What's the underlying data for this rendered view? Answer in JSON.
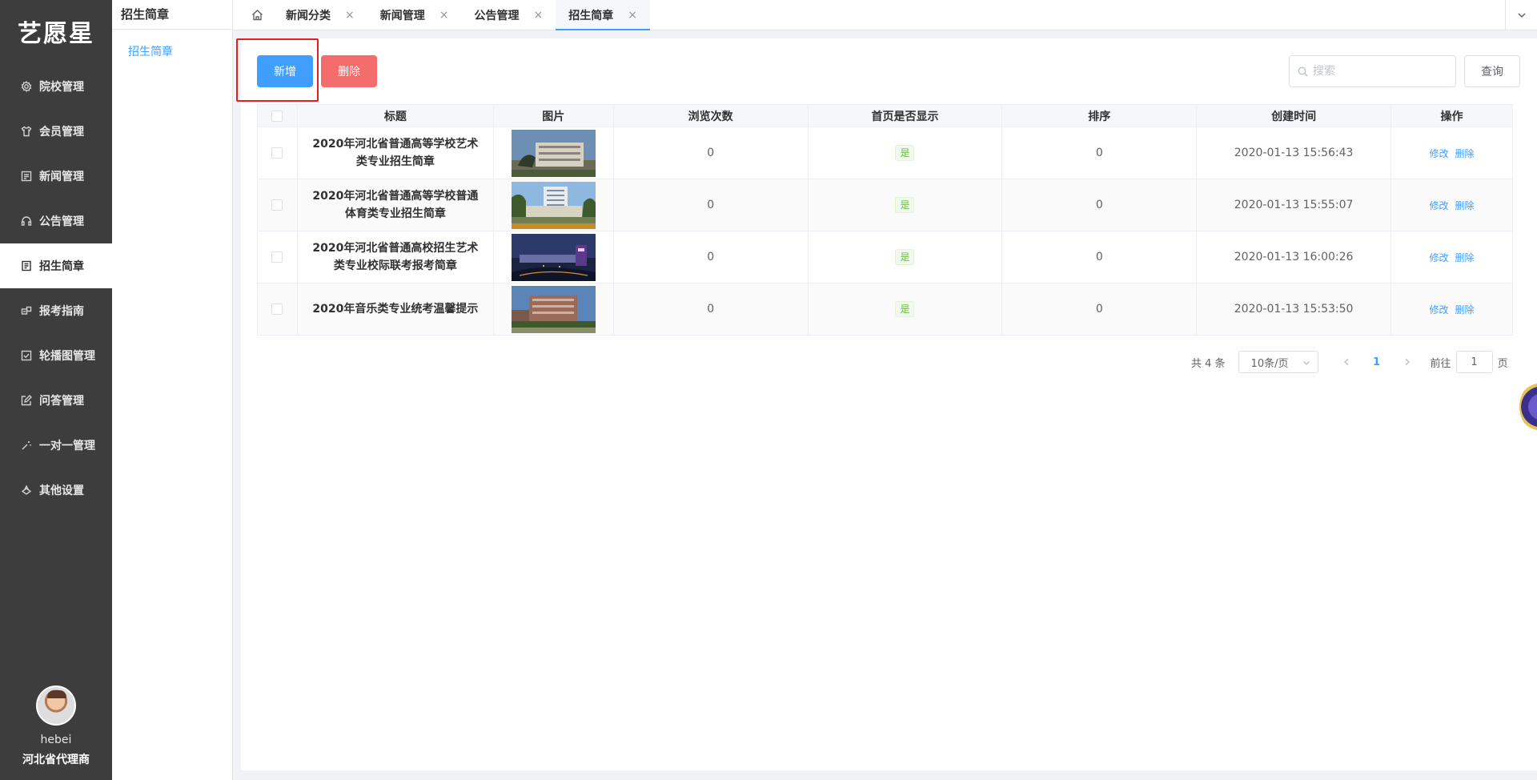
{
  "brand": {
    "logo_text": "艺愿星"
  },
  "sidebar": {
    "items": [
      {
        "label": "院校管理",
        "icon": "gear-icon",
        "active": false
      },
      {
        "label": "会员管理",
        "icon": "shirt-icon",
        "active": false
      },
      {
        "label": "新闻管理",
        "icon": "news-icon",
        "active": false
      },
      {
        "label": "公告管理",
        "icon": "headset-icon",
        "active": false
      },
      {
        "label": "招生简章",
        "icon": "document-icon",
        "active": true
      },
      {
        "label": "报考指南",
        "icon": "guide-icon",
        "active": false
      },
      {
        "label": "轮播图管理",
        "icon": "checkbox-icon",
        "active": false
      },
      {
        "label": "问答管理",
        "icon": "edit-icon",
        "active": false
      },
      {
        "label": "一对一管理",
        "icon": "magic-stick-icon",
        "active": false
      },
      {
        "label": "其他设置",
        "icon": "coin-icon",
        "active": false
      }
    ]
  },
  "user": {
    "name": "hebei",
    "role": "河北省代理商"
  },
  "subsidebar": {
    "title": "招生简章",
    "items": [
      {
        "label": "招生简章"
      }
    ]
  },
  "tabs": [
    {
      "label": "新闻分类",
      "active": false
    },
    {
      "label": "新闻管理",
      "active": false
    },
    {
      "label": "公告管理",
      "active": false
    },
    {
      "label": "招生简章",
      "active": true
    }
  ],
  "tab_close_glyph": "×",
  "toolbar": {
    "add_label": "新增",
    "delete_label": "删除",
    "search_placeholder": "搜索",
    "search_value": "",
    "query_label": "查询"
  },
  "table": {
    "columns": [
      "标题",
      "图片",
      "浏览次数",
      "首页是否显示",
      "排序",
      "创建时间",
      "操作"
    ],
    "rows": [
      {
        "title": "2020年河北省普通高等学校艺术类专业招生简章",
        "views": "0",
        "show_home": "是",
        "sort": "0",
        "created": "2020-01-13 15:56:43"
      },
      {
        "title": "2020年河北省普通高等学校普通体育类专业招生简章",
        "views": "0",
        "show_home": "是",
        "sort": "0",
        "created": "2020-01-13 15:55:07"
      },
      {
        "title": "2020年河北省普通高校招生艺术类专业校际联考报考简章",
        "views": "0",
        "show_home": "是",
        "sort": "0",
        "created": "2020-01-13 16:00:26"
      },
      {
        "title": "2020年音乐类专业统考温馨提示",
        "views": "0",
        "show_home": "是",
        "sort": "0",
        "created": "2020-01-13 15:53:50"
      }
    ],
    "edit_label": "修改",
    "delete_label": "删除"
  },
  "pagination": {
    "total_text": "共 4 条",
    "page_size": "10条/页",
    "current_page": "1",
    "goto_prefix": "前往",
    "goto_value": "1",
    "goto_suffix": "页"
  },
  "colors": {
    "primary": "#409eff",
    "danger": "#f56c6c",
    "sidebar_bg": "#3d3d3d",
    "success": "#67c23a",
    "highlight_border": "#e02020"
  }
}
